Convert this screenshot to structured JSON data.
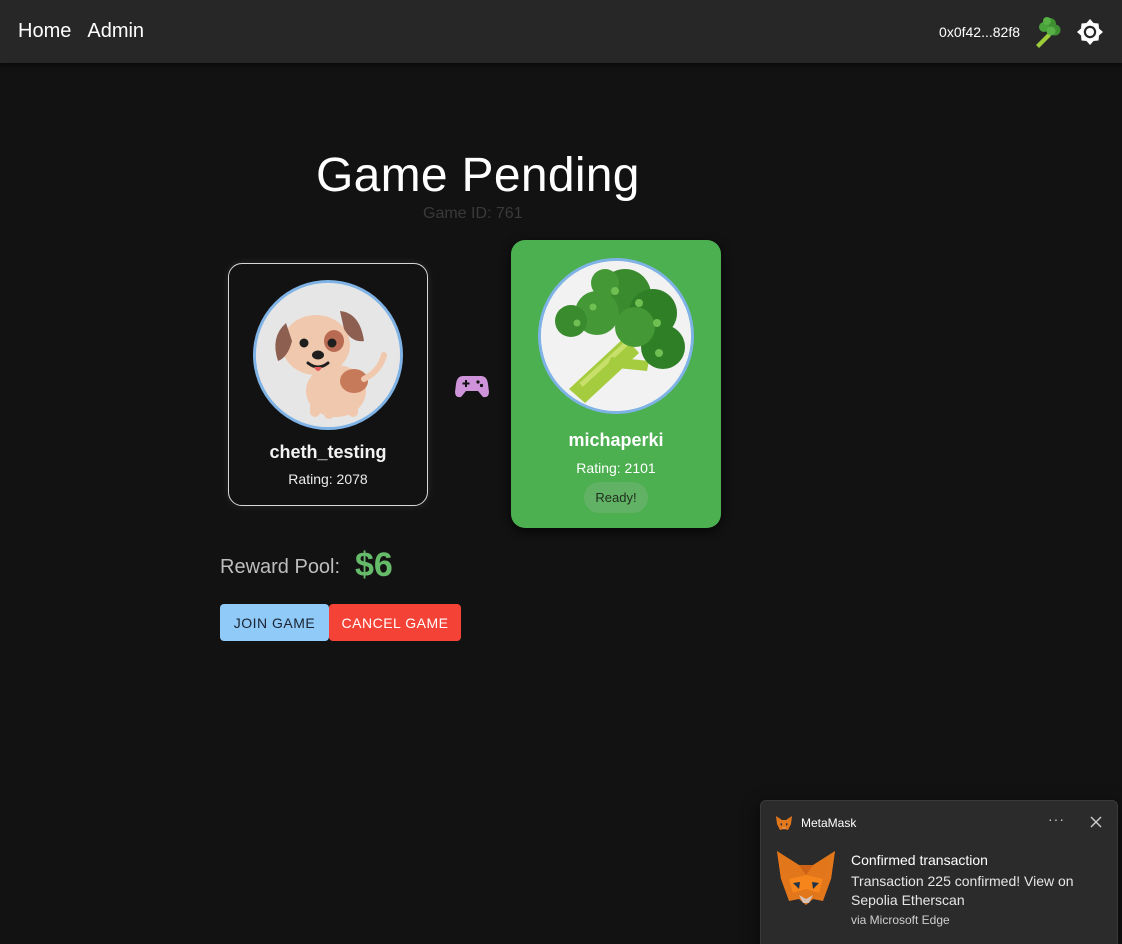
{
  "nav": {
    "home": "Home",
    "admin": "Admin"
  },
  "header": {
    "wallet": "0x0f42...82f8",
    "wallet_icon": "broccoli-emoji",
    "theme_icon": "brightness-icon"
  },
  "game": {
    "title": "Game Pending",
    "game_id": "Game ID: 761"
  },
  "players": [
    {
      "name": "cheth_testing",
      "rating": "Rating: 2078",
      "avatar": "puppy-avatar"
    },
    {
      "name": "michaperki",
      "rating": "Rating: 2101",
      "status": "Ready!",
      "avatar": "broccoli-avatar"
    }
  ],
  "versus_icon": "gamepad-icon",
  "reward": {
    "label": "Reward Pool:",
    "value": "$6"
  },
  "buttons": {
    "join": "Join Game",
    "cancel": "Cancel Game"
  },
  "colors": {
    "accent_green": "#4caf50",
    "reward_green": "#66bb6a",
    "join_blue": "#90caf9",
    "cancel_red": "#f44336"
  },
  "toast": {
    "app": "MetaMask",
    "more": "···",
    "title": "Confirmed transaction",
    "body": "Transaction 225 confirmed! View on Sepolia Etherscan",
    "via": "via Microsoft Edge"
  }
}
